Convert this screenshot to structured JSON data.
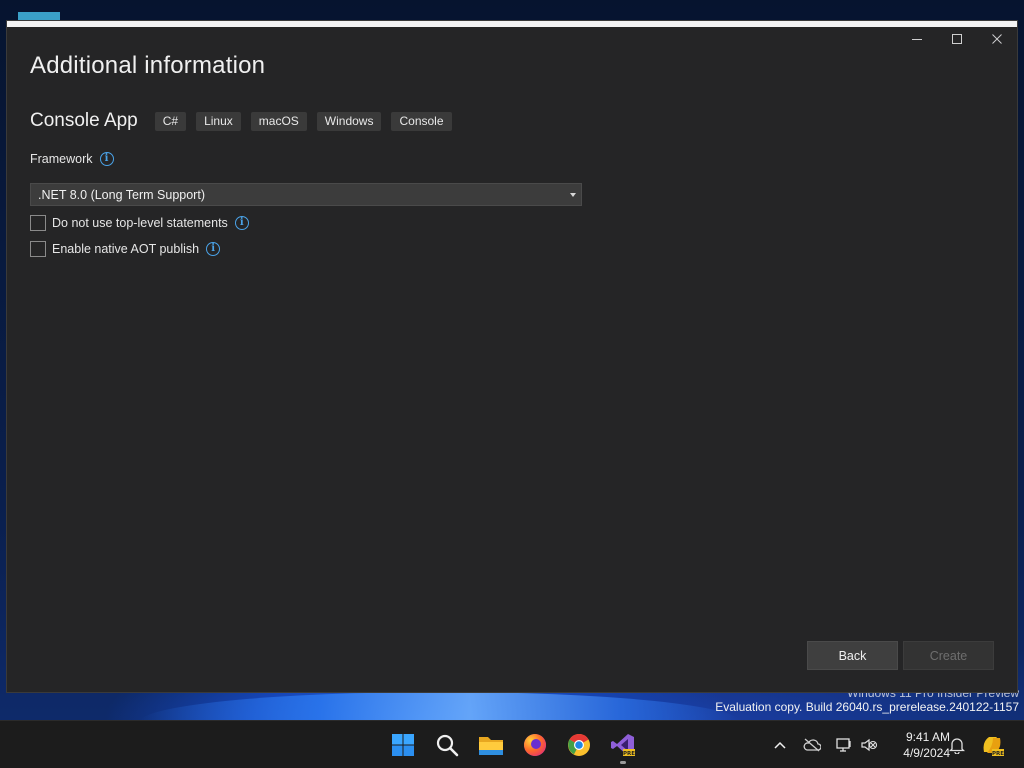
{
  "dialog": {
    "title": "Additional information",
    "template_name": "Console App",
    "tags": [
      "C#",
      "Linux",
      "macOS",
      "Windows",
      "Console"
    ],
    "framework_label": "Framework",
    "framework_value": ".NET 8.0 (Long Term Support)",
    "checkboxes": [
      {
        "label": "Do not use top-level statements",
        "checked": false
      },
      {
        "label": "Enable native AOT publish",
        "checked": false
      }
    ],
    "back_label": "Back",
    "create_label": "Create"
  },
  "window_controls": {
    "minimize": "minimize-icon",
    "maximize": "maximize-icon",
    "close": "close-icon"
  },
  "watermark": {
    "line1": "Windows 11 Pro Insider Preview",
    "line2": "Evaluation copy. Build 26040.rs_prerelease.240122-1157"
  },
  "taskbar": {
    "apps": [
      "start-icon",
      "search-icon",
      "file-explorer-icon",
      "firefox-icon",
      "chrome-icon",
      "visual-studio-preview-icon"
    ],
    "tray": [
      "chevron-up-icon",
      "onedrive-icon",
      "network-icon",
      "volume-muted-icon",
      "notification-icon",
      "copilot-icon"
    ],
    "time": "9:41 AM",
    "date": "4/9/2024"
  },
  "colors": {
    "accent": "#4aa3e8",
    "dialog_bg": "#252526",
    "taskbar_bg": "#1c1c1c"
  }
}
